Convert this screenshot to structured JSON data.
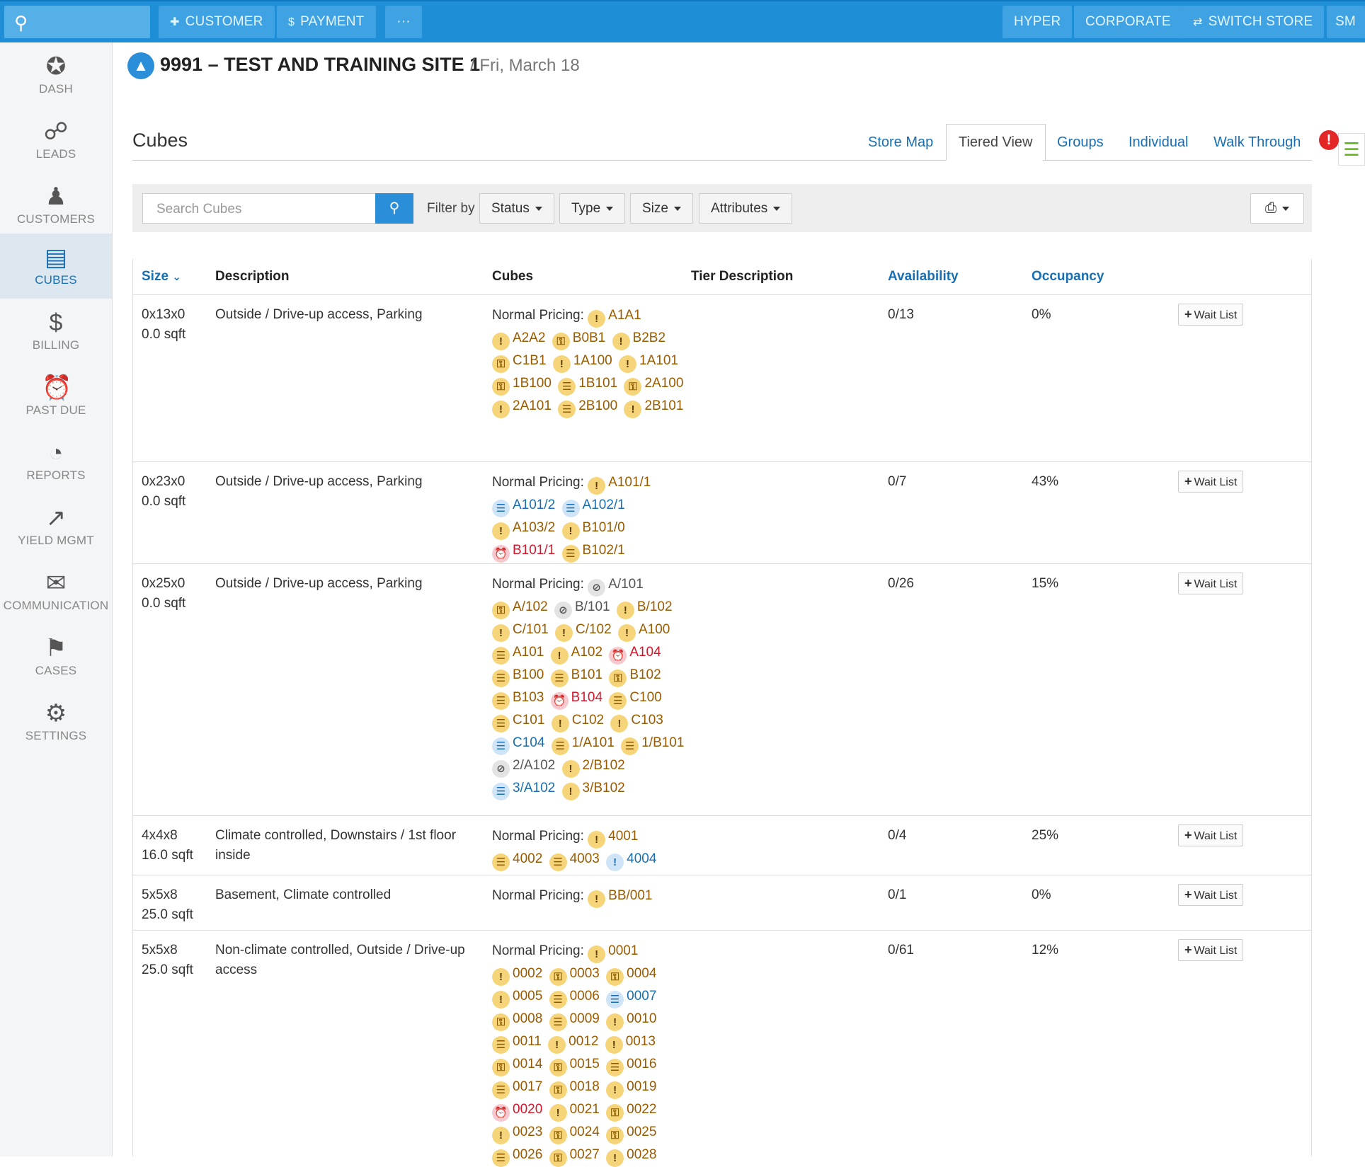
{
  "topbar": {
    "customer": "CUSTOMER",
    "payment": "PAYMENT",
    "more": "···",
    "hyper": "HYPER",
    "corporate": "CORPORATE",
    "switch_store": "SWITCH STORE",
    "user_initials": "SM"
  },
  "sidebar": {
    "items": [
      {
        "label": "DASH",
        "icon": "star-icon"
      },
      {
        "label": "LEADS",
        "icon": "nodes-icon"
      },
      {
        "label": "CUSTOMERS",
        "icon": "person-icon"
      },
      {
        "label": "CUBES",
        "icon": "list-icon"
      },
      {
        "label": "BILLING",
        "icon": "dollar-icon"
      },
      {
        "label": "PAST DUE",
        "icon": "alarm-clock-icon"
      },
      {
        "label": "REPORTS",
        "icon": "pie-chart-icon"
      },
      {
        "label": "YIELD MGMT",
        "icon": "trend-up-icon"
      },
      {
        "label": "COMMUNICATION",
        "icon": "mail-icon"
      },
      {
        "label": "CASES",
        "icon": "bell-icon"
      },
      {
        "label": "SETTINGS",
        "icon": "gear-icon"
      }
    ]
  },
  "header": {
    "site_name": "9991 – TEST AND TRAINING SITE 1",
    "date": "/ Fri, March 18"
  },
  "page": {
    "title": "Cubes",
    "tabs": [
      "Store Map",
      "Tiered View",
      "Groups",
      "Individual",
      "Walk Through"
    ],
    "active_tab": "Tiered View",
    "alert_badge": "!"
  },
  "filters": {
    "search_placeholder": "Search Cubes",
    "filter_by": "Filter by",
    "status": "Status",
    "type": "Type",
    "size": "Size",
    "attributes": "Attributes"
  },
  "table": {
    "headers": {
      "size": "Size",
      "description": "Description",
      "cubes": "Cubes",
      "tier_description": "Tier Description",
      "availability": "Availability",
      "occupancy": "Occupancy"
    },
    "wait_list_label": "Wait List",
    "pricing_label": "Normal Pricing:",
    "rows": [
      {
        "size": "0x13x0",
        "sqft": "0.0 sqft",
        "description": "Outside / Drive-up access, Parking",
        "availability": "0/13",
        "occupancy": "0%",
        "cubes": [
          {
            "id": "A1A1",
            "s": "warn"
          },
          {
            "id": "A2A2",
            "s": "warn"
          },
          {
            "id": "B0B1",
            "s": "lock"
          },
          {
            "id": "B2B2",
            "s": "warn"
          },
          {
            "id": "C1B1",
            "s": "lock"
          },
          {
            "id": "1A100",
            "s": "warn"
          },
          {
            "id": "1A101",
            "s": "warn"
          },
          {
            "id": "1B100",
            "s": "lock"
          },
          {
            "id": "1B101",
            "s": "unit"
          },
          {
            "id": "2A100",
            "s": "lock"
          },
          {
            "id": "2A101",
            "s": "warn"
          },
          {
            "id": "2B100",
            "s": "unit"
          },
          {
            "id": "2B101",
            "s": "warn"
          }
        ]
      },
      {
        "size": "0x23x0",
        "sqft": "0.0 sqft",
        "description": "Outside / Drive-up access, Parking",
        "availability": "0/7",
        "occupancy": "43%",
        "cubes": [
          {
            "id": "A101/1",
            "s": "warn"
          },
          {
            "id": "A101/2",
            "s": "bunit"
          },
          {
            "id": "A102/1",
            "s": "bunit"
          },
          {
            "id": "A103/2",
            "s": "warn"
          },
          {
            "id": "B101/0",
            "s": "warn"
          },
          {
            "id": "B101/1",
            "s": "alarm"
          },
          {
            "id": "B102/1",
            "s": "unit"
          }
        ]
      },
      {
        "size": "0x25x0",
        "sqft": "0.0 sqft",
        "description": "Outside / Drive-up access, Parking",
        "availability": "0/26",
        "occupancy": "15%",
        "cubes": [
          {
            "id": "A/101",
            "s": "ban"
          },
          {
            "id": "A/102",
            "s": "lock"
          },
          {
            "id": "B/101",
            "s": "ban"
          },
          {
            "id": "B/102",
            "s": "warn"
          },
          {
            "id": "C/101",
            "s": "warn"
          },
          {
            "id": "C/102",
            "s": "warn"
          },
          {
            "id": "A100",
            "s": "warn"
          },
          {
            "id": "A101",
            "s": "unit"
          },
          {
            "id": "A102",
            "s": "warn"
          },
          {
            "id": "A104",
            "s": "alarm"
          },
          {
            "id": "B100",
            "s": "unit"
          },
          {
            "id": "B101",
            "s": "unit"
          },
          {
            "id": "B102",
            "s": "lock"
          },
          {
            "id": "B103",
            "s": "unit"
          },
          {
            "id": "B104",
            "s": "alarm"
          },
          {
            "id": "C100",
            "s": "unit"
          },
          {
            "id": "C101",
            "s": "unit"
          },
          {
            "id": "C102",
            "s": "warn"
          },
          {
            "id": "C103",
            "s": "warn"
          },
          {
            "id": "C104",
            "s": "bunit"
          },
          {
            "id": "1/A101",
            "s": "unit"
          },
          {
            "id": "1/B101",
            "s": "unit"
          },
          {
            "id": "2/A102",
            "s": "ban"
          },
          {
            "id": "2/B102",
            "s": "warn"
          },
          {
            "id": "3/A102",
            "s": "bunit"
          },
          {
            "id": "3/B102",
            "s": "warn"
          }
        ]
      },
      {
        "size": "4x4x8",
        "sqft": "16.0 sqft",
        "description": "Climate controlled, Downstairs / 1st floor inside",
        "availability": "0/4",
        "occupancy": "25%",
        "cubes": [
          {
            "id": "4001",
            "s": "warn"
          },
          {
            "id": "4002",
            "s": "unit"
          },
          {
            "id": "4003",
            "s": "unit"
          },
          {
            "id": "4004",
            "s": "bwarn"
          }
        ]
      },
      {
        "size": "5x5x8",
        "sqft": "25.0 sqft",
        "description": "Basement, Climate controlled",
        "availability": "0/1",
        "occupancy": "0%",
        "cubes": [
          {
            "id": "BB/001",
            "s": "warn"
          }
        ]
      },
      {
        "size": "5x5x8",
        "sqft": "25.0 sqft",
        "description": "Non-climate controlled, Outside / Drive-up access",
        "availability": "0/61",
        "occupancy": "12%",
        "cubes": [
          {
            "id": "0001",
            "s": "warn"
          },
          {
            "id": "0002",
            "s": "warn"
          },
          {
            "id": "0003",
            "s": "lock"
          },
          {
            "id": "0004",
            "s": "lock"
          },
          {
            "id": "0005",
            "s": "warn"
          },
          {
            "id": "0006",
            "s": "unit"
          },
          {
            "id": "0007",
            "s": "bunit"
          },
          {
            "id": "0008",
            "s": "lock"
          },
          {
            "id": "0009",
            "s": "unit"
          },
          {
            "id": "0010",
            "s": "warn"
          },
          {
            "id": "0011",
            "s": "unit"
          },
          {
            "id": "0012",
            "s": "warn"
          },
          {
            "id": "0013",
            "s": "warn"
          },
          {
            "id": "0014",
            "s": "lock"
          },
          {
            "id": "0015",
            "s": "lock"
          },
          {
            "id": "0016",
            "s": "unit"
          },
          {
            "id": "0017",
            "s": "unit"
          },
          {
            "id": "0018",
            "s": "lock"
          },
          {
            "id": "0019",
            "s": "warn"
          },
          {
            "id": "0020",
            "s": "alarm"
          },
          {
            "id": "0021",
            "s": "warn"
          },
          {
            "id": "0022",
            "s": "lock"
          },
          {
            "id": "0023",
            "s": "warn"
          },
          {
            "id": "0024",
            "s": "lock"
          },
          {
            "id": "0025",
            "s": "lock"
          },
          {
            "id": "0026",
            "s": "unit"
          },
          {
            "id": "0027",
            "s": "lock"
          },
          {
            "id": "0028",
            "s": "warn"
          }
        ]
      }
    ]
  },
  "status_icons": {
    "warn": "warning-icon",
    "lock": "lock-icon",
    "unit": "unit-icon",
    "bunit": "unit-icon",
    "bwarn": "warning-icon",
    "alarm": "alarm-icon",
    "ban": "ban-icon"
  },
  "colors": {
    "topbar": "#1e8fd6",
    "link": "#1a6fb3",
    "warning": "#f6d57a",
    "alarm": "#d6162c"
  }
}
